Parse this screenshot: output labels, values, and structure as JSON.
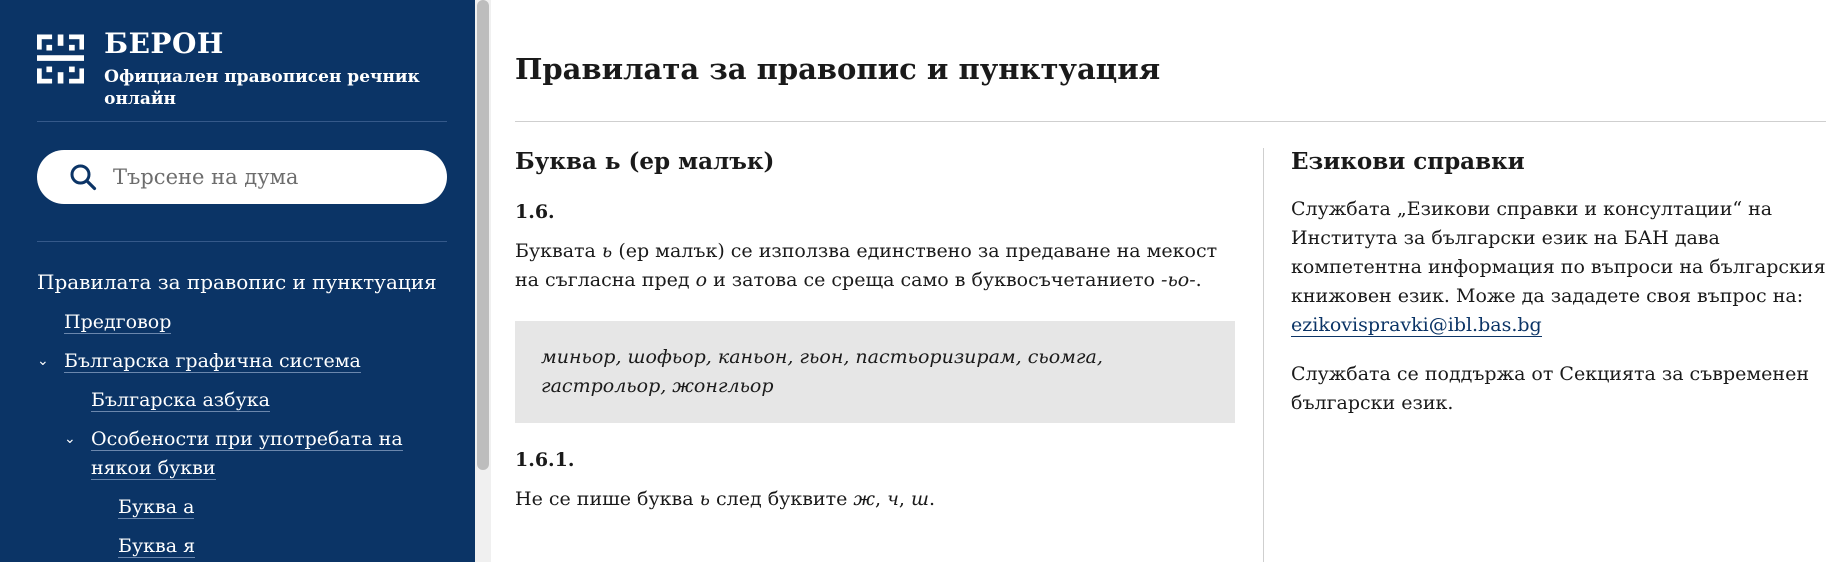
{
  "brand": {
    "title": "БЕРОН",
    "subtitle": "Официален правописен речник онлайн",
    "logo_icon": "beron-logo-icon"
  },
  "search": {
    "placeholder": "Търсене на дума",
    "icon": "search-icon"
  },
  "nav": {
    "items": [
      {
        "label": "Правилата за правопис и пунктуация",
        "level": 0
      },
      {
        "label": "Предговор",
        "level": 1
      },
      {
        "label": "Българска графична система",
        "level": 1,
        "expanded": true
      },
      {
        "label": "Българска азбука",
        "level": 2
      },
      {
        "label": "Особености при употребата на някои букви",
        "level": 2,
        "expanded": true
      },
      {
        "label": "Буква а",
        "level": 3
      },
      {
        "label": "Буква я",
        "level": 3
      }
    ]
  },
  "main": {
    "page_title": "Правилата за правопис и пунктуация",
    "section_title": "Буква ь (ер малък)",
    "sub1": "1.6.",
    "para1_a": "Буквата ",
    "para1_b": "ь",
    "para1_c": " (ер малък) се използва единствено за предаване на мекост на съгласна пред ",
    "para1_d": "о",
    "para1_e": " и затова се среща само в буквосъчетанието ",
    "para1_f": "-ьо-",
    "para1_g": ".",
    "example": "миньор, шофьор, каньон, гьон, пастьоризирам, сьомга, гастрольор, жонгльор",
    "sub2": "1.6.1.",
    "para2_a": "Не се пише буква ",
    "para2_b": "ь",
    "para2_c": " след буквите ",
    "para2_d": "ж",
    "para2_e": ", ",
    "para2_f": "ч",
    "para2_g": ", ",
    "para2_h": "ш",
    "para2_i": "."
  },
  "aside": {
    "title": "Езикови справки",
    "p1": "Службата „Езикови справки и консултации“ на Института за български език на БАН дава компетентна информация по въпроси на българския книжовен език. Може да зададете своя въпрос на:",
    "email": "ezikovispravki@ibl.bas.bg",
    "p2": "Службата се поддържа от Секцията за съвременен български език."
  },
  "colors": {
    "sidebar_bg": "#0b3466",
    "example_bg": "#e6e6e6",
    "link": "#0b3466"
  }
}
